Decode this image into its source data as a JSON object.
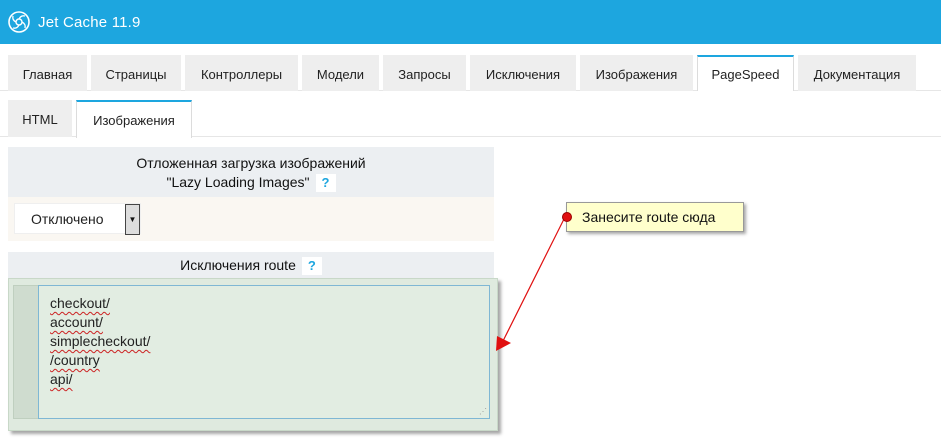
{
  "app": {
    "title": "Jet Cache 11.9",
    "logo_icon": "jet-cache-logo-icon",
    "accent_color": "#1da6df"
  },
  "main_tabs": [
    {
      "label": "Главная",
      "active": false
    },
    {
      "label": "Страницы",
      "active": false
    },
    {
      "label": "Контроллеры",
      "active": false
    },
    {
      "label": "Модели",
      "active": false
    },
    {
      "label": "Запросы",
      "active": false
    },
    {
      "label": "Исключения",
      "active": false
    },
    {
      "label": "Изображения",
      "active": false
    },
    {
      "label": "PageSpeed",
      "active": true
    },
    {
      "label": "Документация",
      "active": false
    }
  ],
  "sub_tabs": [
    {
      "label": "HTML",
      "active": false
    },
    {
      "label": "Изображения",
      "active": true
    }
  ],
  "lazy_loading": {
    "title_line1": "Отложенная загрузка изображений",
    "title_line2": "\"Lazy Loading Images\"",
    "help": "?",
    "selected_value": "Отключено"
  },
  "route_exclusions": {
    "title": "Исключения route",
    "help": "?",
    "lines": [
      "checkout/",
      "account/",
      "simplecheckout/",
      "/country",
      "api/"
    ]
  },
  "annotation": {
    "text": "Занесите route сюда",
    "arrow_color": "#e01010"
  }
}
